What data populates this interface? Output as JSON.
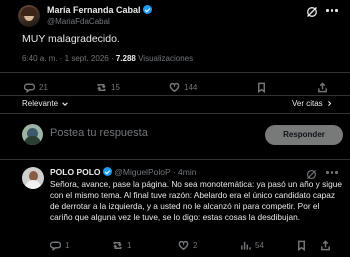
{
  "tweet": {
    "author_name": "María Fernanda Cabal",
    "author_handle": "@MariaFdaCabal",
    "text": "MUY malagradecido.",
    "time": "6:40 a. m. · 1 sept. 2026 ·",
    "views_count": "7.288",
    "views_label": "Visualizaciones",
    "replies": "21",
    "retweets": "15",
    "likes": "144"
  },
  "sort": {
    "label": "Relevante",
    "view_quotes": "Ver citas"
  },
  "compose": {
    "placeholder": "Postea tu respuesta",
    "reply_button": "Responder"
  },
  "reply": {
    "author_name": "POLO POLO",
    "author_handle": "@MiguelPoloP",
    "time": "· 4min",
    "text": "Señora, avance, pase la página. No sea monotemática: ya pasó un año y sigue con el mismo tema. Al final tuve razón: Abelardo era el único candidato capaz de derrotar a la izquierda, y a usted no le alcanzó ni para competir. Por el cariño que alguna vez le tuve, se lo digo: estas cosas la desdibujan.",
    "replies": "1",
    "retweets": "1",
    "likes": "2",
    "views": "54"
  },
  "colors": {
    "accent": "#1d9bf0",
    "bg": "#000000",
    "text": "#e7e9ea",
    "muted": "#71767b",
    "border": "#2f3336"
  }
}
